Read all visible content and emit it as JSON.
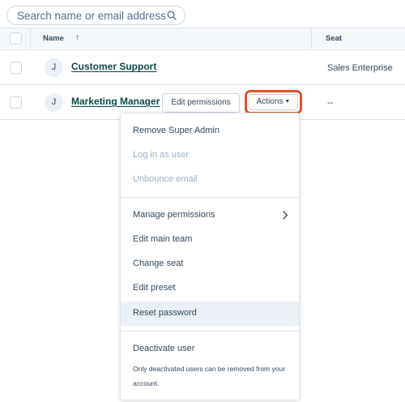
{
  "search": {
    "placeholder": "Search name or email address"
  },
  "table": {
    "headers": {
      "name": "Name",
      "sort_indicator": "↑",
      "seat": "Seat"
    },
    "rows": [
      {
        "avatar": "J",
        "name": "Customer Support",
        "seat": "Sales Enterprise"
      },
      {
        "avatar": "J",
        "name": "Marketing Manager",
        "seat": "--",
        "edit_label": "Edit permissions",
        "actions_label": "Actions",
        "actions_caret": "▼"
      }
    ]
  },
  "menu": {
    "items": [
      {
        "label": "Remove Super Admin",
        "disabled": false
      },
      {
        "label": "Log in as user",
        "disabled": true
      },
      {
        "label": "Unbounce email",
        "disabled": true
      },
      {
        "label": "Manage permissions",
        "disabled": false,
        "submenu": true
      },
      {
        "label": "Edit main team",
        "disabled": false
      },
      {
        "label": "Change seat",
        "disabled": false
      },
      {
        "label": "Edit preset",
        "disabled": false
      },
      {
        "label": "Reset password",
        "disabled": false,
        "highlighted": true
      },
      {
        "label": "Deactivate user",
        "disabled": false
      }
    ],
    "deactivate_note": "Only deactivated users can be removed from your account."
  },
  "colors": {
    "highlight_ring": "#e0552c",
    "link": "#0b4b49",
    "text": "#33475b",
    "disabled": "#99afc4"
  },
  "icons": [
    "search-icon",
    "sort-ascending-icon",
    "chevron-right-icon",
    "caret-down-icon"
  ]
}
